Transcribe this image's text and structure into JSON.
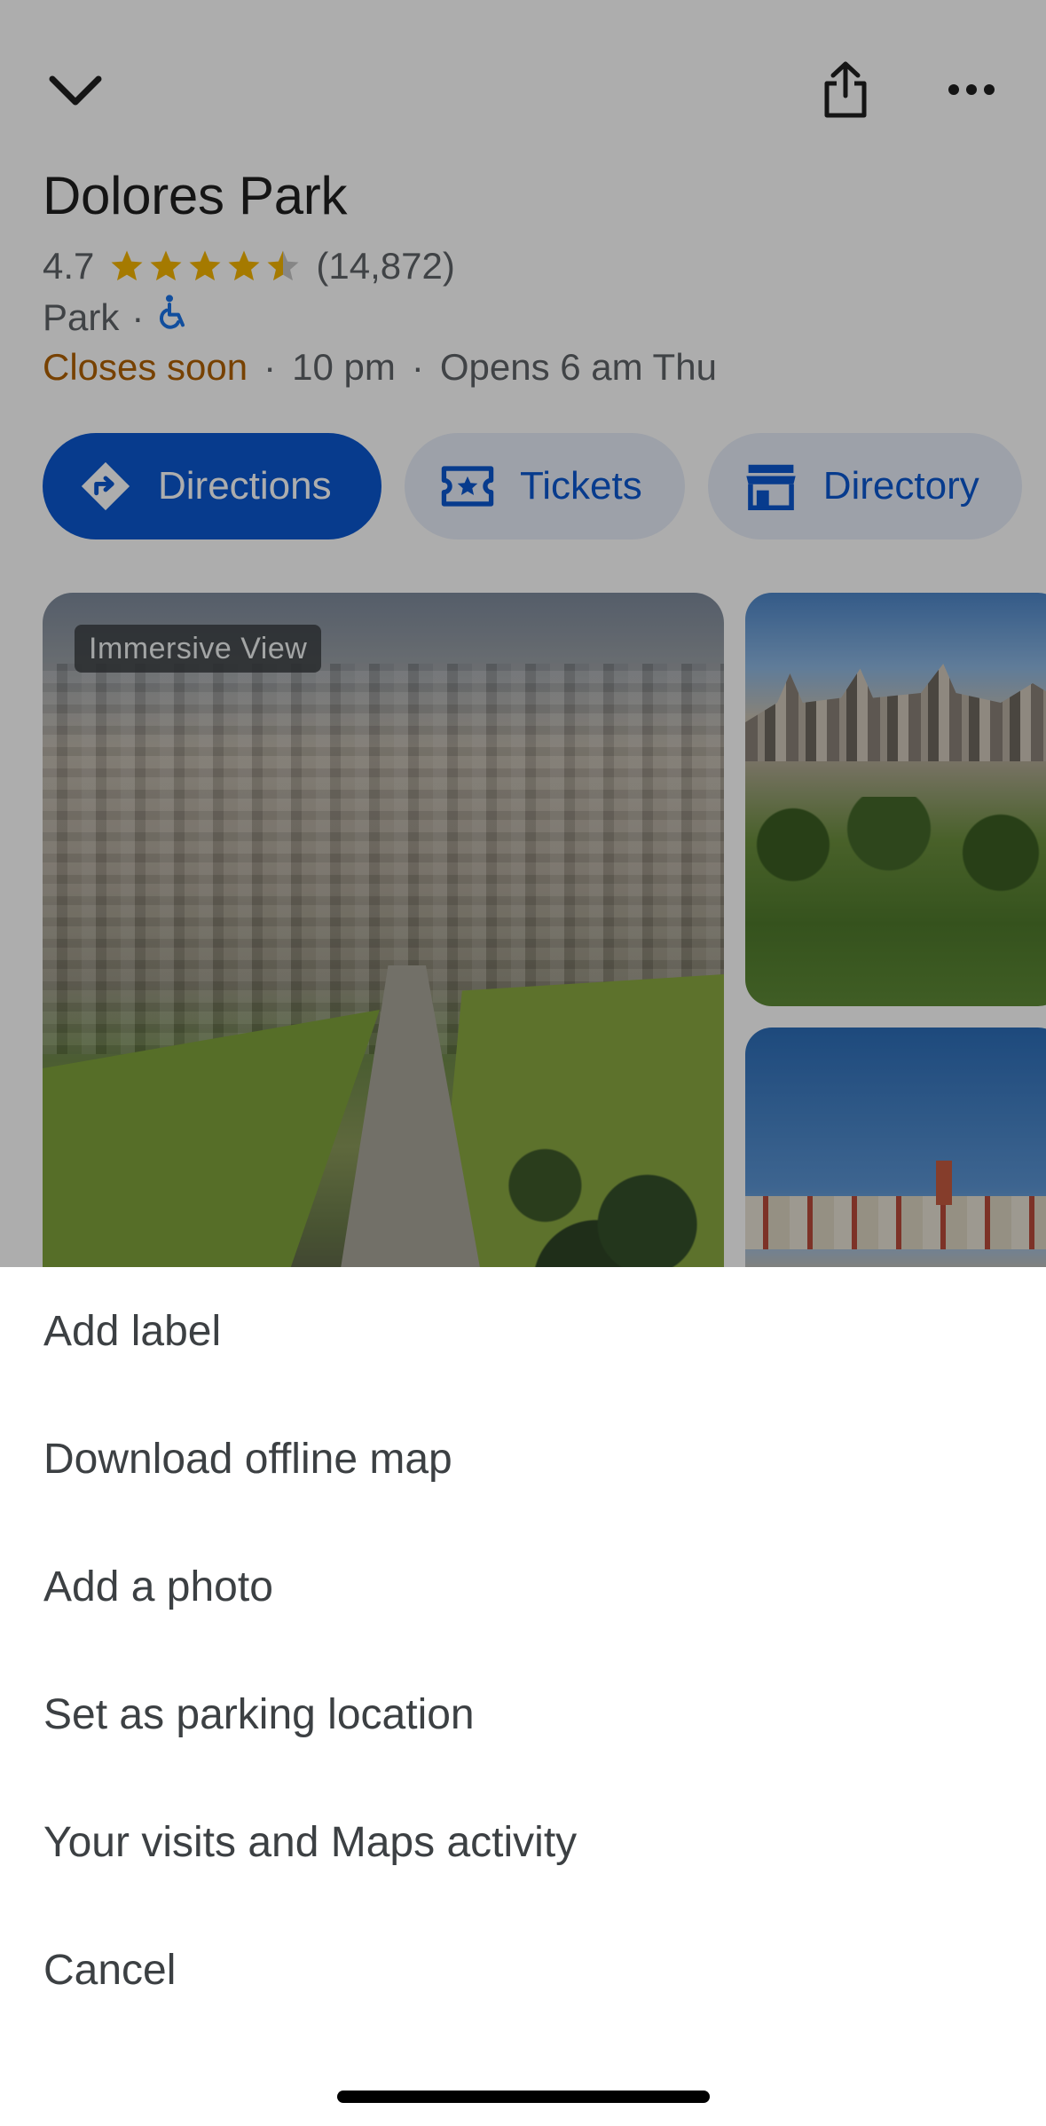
{
  "place": {
    "title": "Dolores Park",
    "rating": "4.7",
    "stars": 4.5,
    "review_count": "(14,872)",
    "category": "Park",
    "category_separator": "·",
    "accessibility_icon": "wheelchair-icon",
    "status": "Closes soon",
    "status_separator": "·",
    "closing_time": "10 pm",
    "hours_separator": "·",
    "next_open": "Opens 6 am Thu"
  },
  "topbar": {
    "back_icon": "chevron-down-icon",
    "share_icon": "share-icon",
    "more_icon": "more-horizontal-icon"
  },
  "actions": [
    {
      "label": "Directions",
      "icon": "directions-icon"
    },
    {
      "label": "Tickets",
      "icon": "ticket-icon"
    },
    {
      "label": "Directory",
      "icon": "storefront-icon"
    }
  ],
  "photos": {
    "main_badge": "Immersive View"
  },
  "menu": {
    "items": [
      {
        "label": "Add label"
      },
      {
        "label": "Download offline map"
      },
      {
        "label": "Add a photo"
      },
      {
        "label": "Set as parking location"
      },
      {
        "label": "Your visits and Maps activity"
      },
      {
        "label": "Cancel"
      }
    ]
  },
  "colors": {
    "accent": "#0b57d0",
    "chip_bg": "#e8eef9",
    "star": "#f4b400",
    "closes_soon": "#b06000",
    "scrim": "rgba(0,0,0,0.32)"
  }
}
